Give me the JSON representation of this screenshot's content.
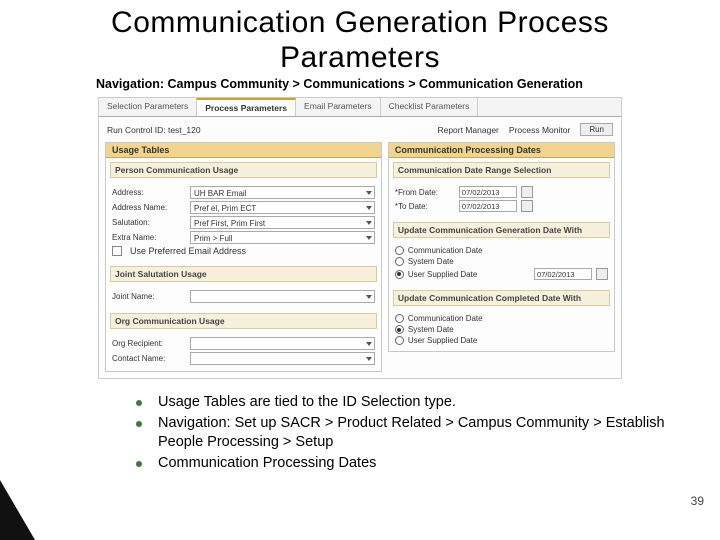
{
  "title": "Communication Generation Process Parameters",
  "nav_line": "Navigation: Campus Community > Communications > Communication Generation",
  "screenshot": {
    "tabs": [
      "Selection Parameters",
      "Process Parameters",
      "Email Parameters",
      "Checklist Parameters"
    ],
    "run_control_label": "Run Control ID:",
    "run_control_value": "test_120",
    "report_manager": "Report Manager",
    "process_monitor": "Process Monitor",
    "run_btn": "Run",
    "usage_tables_head": "Usage Tables",
    "pcu_sub": "Person Communication Usage",
    "address_lbl": "Address:",
    "address_val": "UH BAR Email",
    "address_name_lbl": "Address Name:",
    "address_name_val": "Pref el, Prim ECT",
    "salutation_lbl": "Salutation:",
    "salutation_val": "Pref First, Prim First",
    "extra_name_lbl": "Extra Name:",
    "extra_name_val": "Prim > Full",
    "pref_email_chk": "Use Preferred Email Address",
    "joint_sub": "Joint Salutation Usage",
    "joint_name_lbl": "Joint Name:",
    "org_sub": "Org Communication Usage",
    "org_recipient_lbl": "Org Recipient:",
    "contact_name_lbl": "Contact Name:",
    "cpd_head": "Communication Processing Dates",
    "cdrs_sub": "Communication Date Range Selection",
    "from_lbl": "*From Date:",
    "from_val": "07/02/2013",
    "to_lbl": "*To Date:",
    "to_val": "07/02/2013",
    "ucgd_sub": "Update Communication Generation Date With",
    "opt_comm_date": "Communication Date",
    "opt_sys_date": "System Date",
    "opt_user_date": "User Supplied Date",
    "user_date_val": "07/02/2013",
    "uccd_sub": "Update Communication Completed Date With"
  },
  "bullets": {
    "b1": "Usage Tables are tied to the ID Selection type.",
    "b2": "Navigation: Set up SACR > Product Related > Campus Community > Establish People Processing > Setup",
    "b3": "Communication Processing Dates"
  },
  "page_number": "39"
}
